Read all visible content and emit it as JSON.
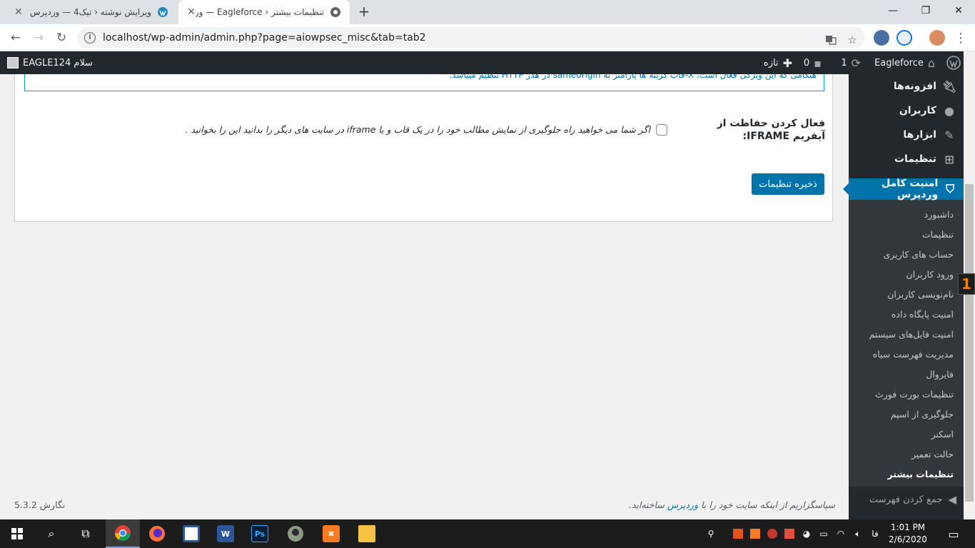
{
  "browser": {
    "tabs": [
      {
        "title": "ویرایش نوشته ‹ تیک4 — وردپرس",
        "active": false
      },
      {
        "title": "تنظیمات بیشتر ‹ Eagleforce — ورد",
        "active": true
      }
    ],
    "new_tab": "+",
    "url": "localhost/wp-admin/admin.php?page=aiowpsec_misc&tab=tab2"
  },
  "adminbar": {
    "site_name": "Eagleforce",
    "updates_count": "1",
    "comments_count": "0",
    "new_label": "تازه",
    "greeting": "سلام EAGLE124"
  },
  "sidebar": {
    "top_items": [
      {
        "label": "افزونه‌ها",
        "icon": "plugin-icon"
      },
      {
        "label": "کاربران",
        "icon": "users-icon"
      },
      {
        "label": "ابزارها",
        "icon": "tools-icon"
      },
      {
        "label": "تنظیمات",
        "icon": "settings-icon"
      }
    ],
    "current": {
      "label": "امنیت کامل وردپرس",
      "icon": "shield-icon"
    },
    "submenu": [
      "داشبورد",
      "تنظیمات",
      "حساب های کاربری",
      "ورود کاربران",
      "نام‌نویسی کاربران",
      "امنیت پایگاه داده",
      "امنیت فایل‌های سیستم",
      "مدیریت فهرست سیاه",
      "فایروال",
      "تنظیمات بورت فورث",
      "جلوگیری از اسپم",
      "اسکنر",
      "حالت تعمیر",
      "تنظیمات بیشتر"
    ],
    "active_submenu": "تنظیمات بیشتر",
    "collapse_label": "جمع کردن فهرست"
  },
  "content": {
    "notice_text": "هنگامی که این ویژگی فعال است، X-قاب گزینه ها پارامتر به sameorigin در هدر HTTP تنظیم میباشد.",
    "field_label": "فعال کردن حفاظت از آیفریم IFRAME:",
    "field_description": "اگر شما می خواهید راه جلوگیری از نمایش مطالب خود را در یک قاب و یا iframe در سایت های دیگر را بدانید این را بخوانید .",
    "checkbox_checked": false,
    "save_button": "ذخیره تنظیمات"
  },
  "footer": {
    "version": "نگارش 5.3.2",
    "thanks_prefix": "سپاسگزاریم از اینکه سایت خود را با",
    "thanks_link": "وردپرس",
    "thanks_suffix": "ساخته‌اید."
  },
  "taskbar": {
    "time": "1:01 PM",
    "date": "2/6/2020",
    "lang": "فا"
  },
  "badge": "1"
}
